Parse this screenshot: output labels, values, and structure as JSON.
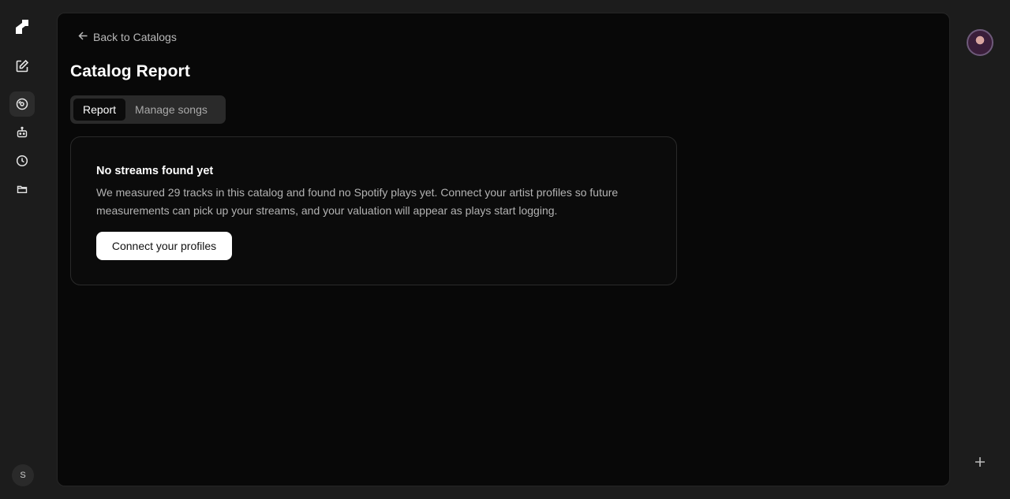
{
  "rail": {
    "items": [
      {
        "name": "new-note",
        "icon": "edit-icon"
      },
      {
        "name": "catalogs",
        "icon": "disc-icon",
        "active": true
      },
      {
        "name": "robot",
        "icon": "robot-icon"
      },
      {
        "name": "history",
        "icon": "clock-icon"
      },
      {
        "name": "folder",
        "icon": "folder-icon"
      }
    ],
    "user_initial": "S"
  },
  "header": {
    "back_label": "Back to Catalogs",
    "title": "Catalog Report"
  },
  "tabs": [
    {
      "label": "Report",
      "active": true
    },
    {
      "label": "Manage songs",
      "active": false
    }
  ],
  "empty_state": {
    "title": "No streams found yet",
    "body": "We measured 29 tracks in this catalog and found no Spotify plays yet. Connect your artist profiles so future measurements can pick up your streams, and your valuation will appear as plays start logging.",
    "cta_label": "Connect your profiles"
  },
  "colors": {
    "background": "#1c1c1c",
    "panel": "#080808",
    "cta_background": "#ffffff"
  }
}
